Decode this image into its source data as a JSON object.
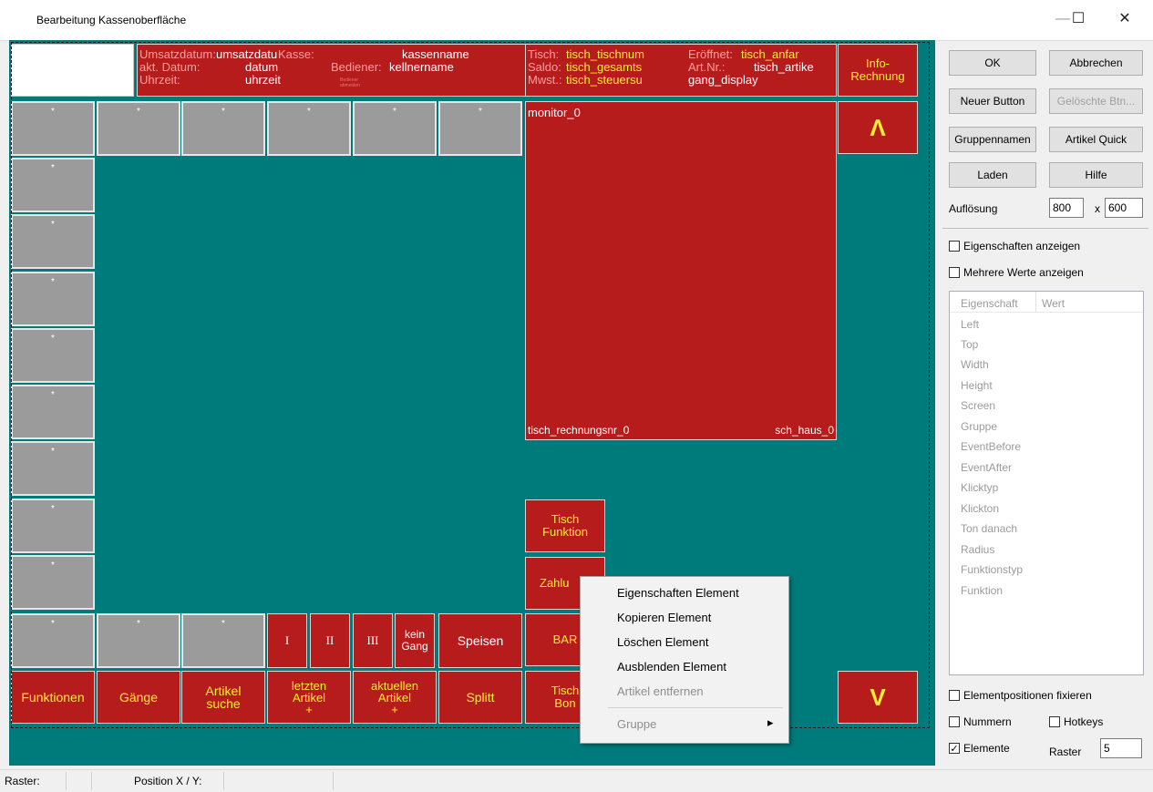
{
  "window": {
    "title": "Bearbeitung Kassenoberfläche",
    "minimize": "—",
    "maximize": "☐",
    "close": "✕"
  },
  "header_left": {
    "umsatzdatum_label": "Umsatzdatum:",
    "umsatzdatum_value": "umsatzdatu",
    "aktdatum_label": "akt. Datum:",
    "aktdatum_value": "datum",
    "uhrzeit_label": "Uhrzeit:",
    "uhrzeit_value": "uhrzeit",
    "kasse_label": "Kasse:",
    "kasse_value": "kassenname",
    "bediener_label": "Bediener:",
    "bediener_value": "kellnername",
    "tiny_label": "Bediener abmelden"
  },
  "header_right": {
    "tisch_label": "Tisch:",
    "tisch_value": "tisch_tischnum",
    "saldo_label": "Saldo:",
    "saldo_value": "tisch_gesamts",
    "mwst_label": "Mwst.:",
    "mwst_value": "tisch_steuersu",
    "eroeffnet_label": "Eröffnet:",
    "eroeffnet_value": "tisch_anfar",
    "artnr_label": "Art.Nr.:",
    "artnr_value": "tisch_artike",
    "gang_value": "gang_display"
  },
  "canvas": {
    "info_button": "Info-\nRechnung",
    "star": "*",
    "monitor_label": "monitor_0",
    "rechnungsnr": "tisch_rechnungsnr_0",
    "haus": "sch_haus_0",
    "up_arrow": "Λ",
    "down_arrow": "V",
    "tisch_funktion": "Tisch\nFunktion",
    "zahlung": "Zahlu",
    "bar": "BAR",
    "tisch_bon": "Tisch\nBon",
    "gang_I": "I",
    "gang_II": "II",
    "gang_III": "III",
    "kein_gang": "kein\nGang",
    "speisen": "Speisen",
    "funktionen": "Funktionen",
    "gaenge": "Gänge",
    "artikel_suche": "Artikel\nsuche",
    "letzten_artikel": "letzten\nArtikel\n+",
    "aktuellen_artikel": "aktuellen\nArtikel\n+",
    "splitt": "Splitt"
  },
  "context_menu": {
    "items": [
      "Eigenschaften Element",
      "Kopieren Element",
      "Löschen Element",
      "Ausblenden Element",
      "Artikel entfernen",
      "Gruppe"
    ],
    "submenu_arrow": "▸"
  },
  "sidebar": {
    "ok": "OK",
    "abbrechen": "Abbrechen",
    "neuer_button": "Neuer Button",
    "geloeschte_btn": "Gelöschte Btn...",
    "gruppennamen": "Gruppennamen",
    "artikel_quick": "Artikel Quick",
    "laden": "Laden",
    "hilfe": "Hilfe",
    "aufloesung_label": "Auflösung",
    "res_w": "800",
    "res_x": "x",
    "res_h": "600",
    "eigenschaften_anzeigen": "Eigenschaften anzeigen",
    "mehrere_werte": "Mehrere Werte anzeigen",
    "col_eigenschaft": "Eigenschaft",
    "col_wert": "Wert",
    "props": [
      "Left",
      "Top",
      "Width",
      "Height",
      "Screen",
      "Gruppe",
      "EventBefore",
      "EventAfter",
      "Klicktyp",
      "Klickton",
      "Ton danach",
      "Radius",
      "Funktionstyp",
      "Funktion"
    ],
    "elementpositionen": "Elementpositionen fixieren",
    "nummern": "Nummern",
    "hotkeys": "Hotkeys",
    "elemente": "Elemente",
    "elemente_checked": "✓",
    "raster_label": "Raster",
    "raster_value": "5"
  },
  "statusbar": {
    "raster": "Raster:",
    "position": "Position X / Y:"
  }
}
